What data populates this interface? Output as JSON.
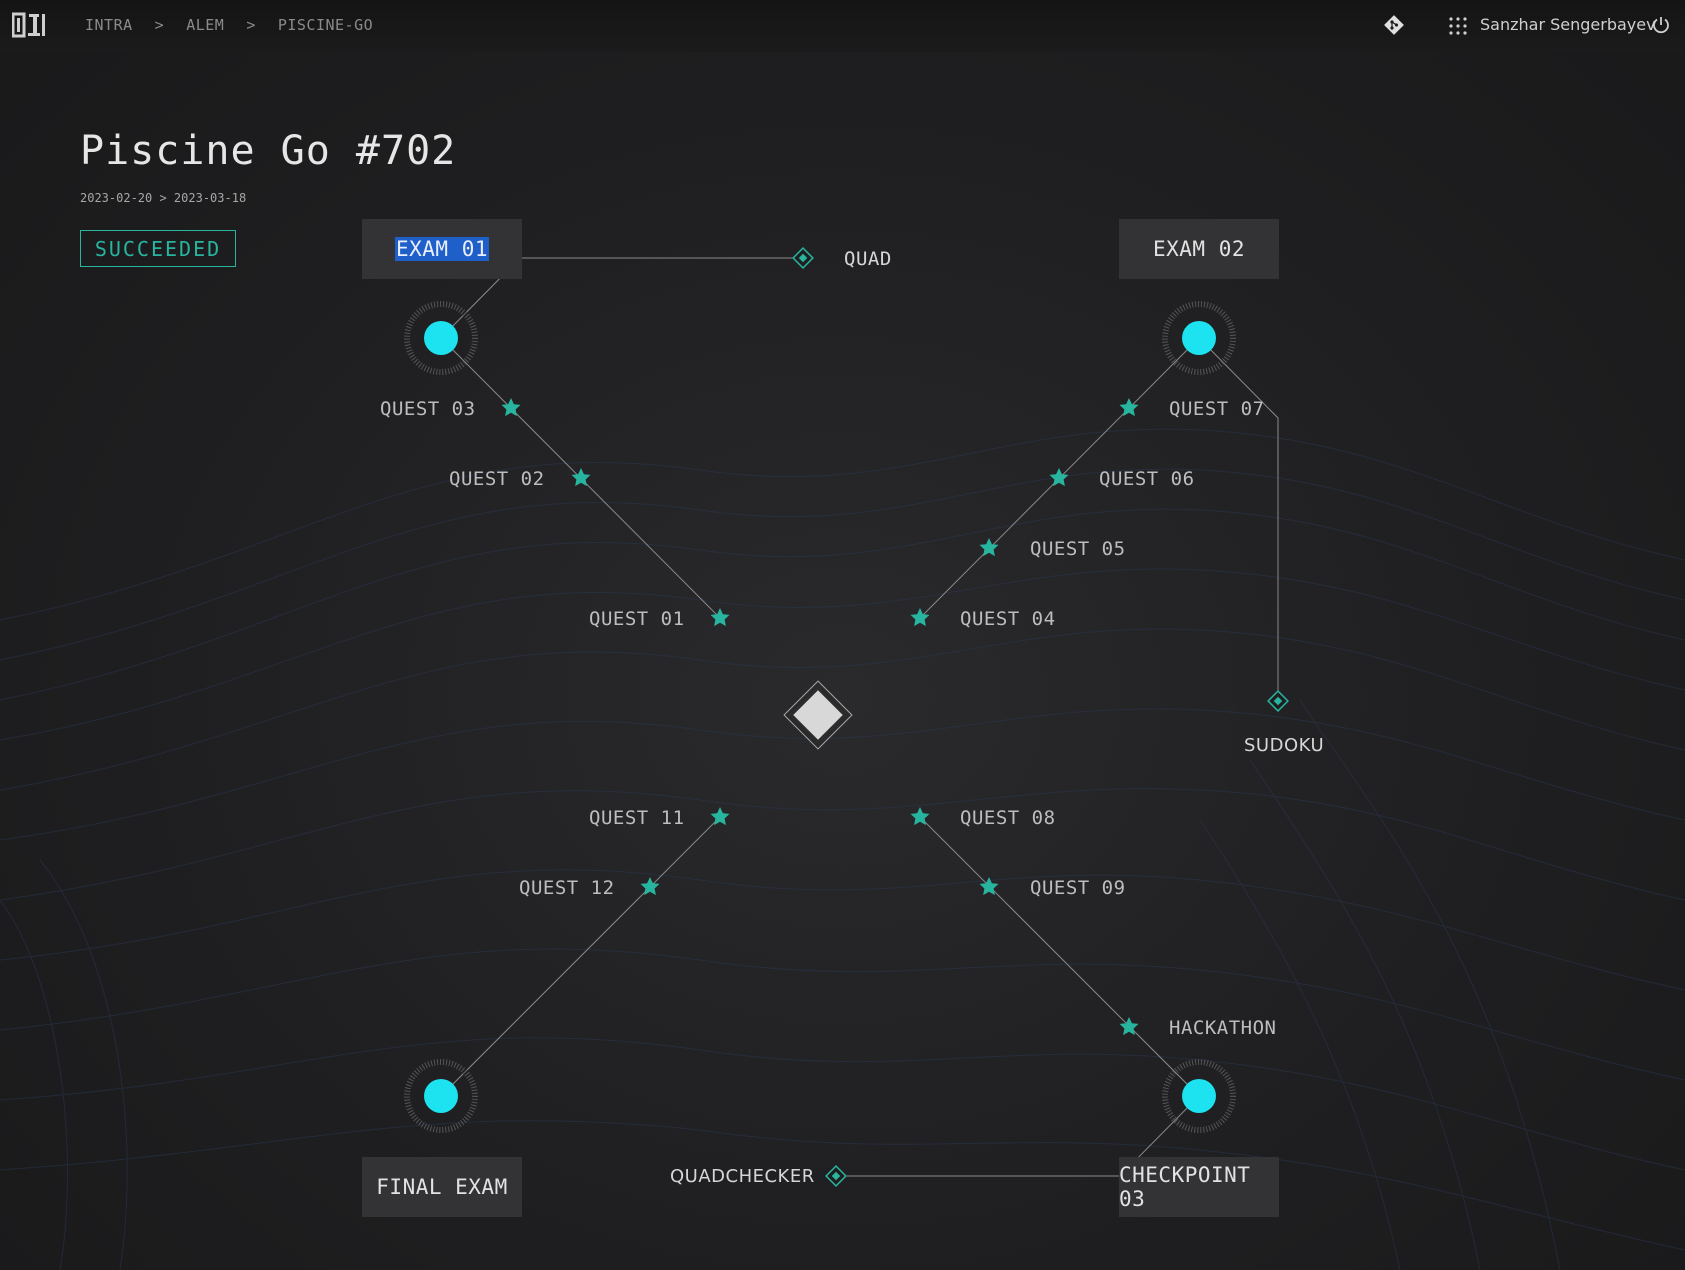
{
  "header": {
    "breadcrumbs": [
      "INTRA",
      "ALEM",
      "PISCINE-GO"
    ],
    "separator": ">",
    "user_name": "Sanzhar Sengerbayev",
    "icons": [
      "logo-01",
      "git-icon",
      "apps-grid-icon",
      "power-icon"
    ]
  },
  "page": {
    "title": "Piscine Go #702",
    "dates": "2023-02-20 > 2023-03-18",
    "status": "SUCCEEDED"
  },
  "nodes": {
    "exam01": "EXAM 01",
    "exam02": "EXAM 02",
    "final_exam": "FINAL EXAM",
    "checkpoint03": "CHECKPOINT 03",
    "quad": "QUAD",
    "sudoku": "SUDOKU",
    "quadchecker": "QUADCHECKER",
    "quest01": "QUEST 01",
    "quest02": "QUEST 02",
    "quest03": "QUEST 03",
    "quest04": "QUEST 04",
    "quest05": "QUEST 05",
    "quest06": "QUEST 06",
    "quest07": "QUEST 07",
    "quest08": "QUEST 08",
    "quest09": "QUEST 09",
    "quest11": "QUEST 11",
    "quest12": "QUEST 12",
    "hackathon": "HACKATHON"
  },
  "colors": {
    "accent": "#28b5a0",
    "node_fill": "#1de3f0",
    "selection": "#1f5fc9",
    "background": "#1f1f21"
  }
}
